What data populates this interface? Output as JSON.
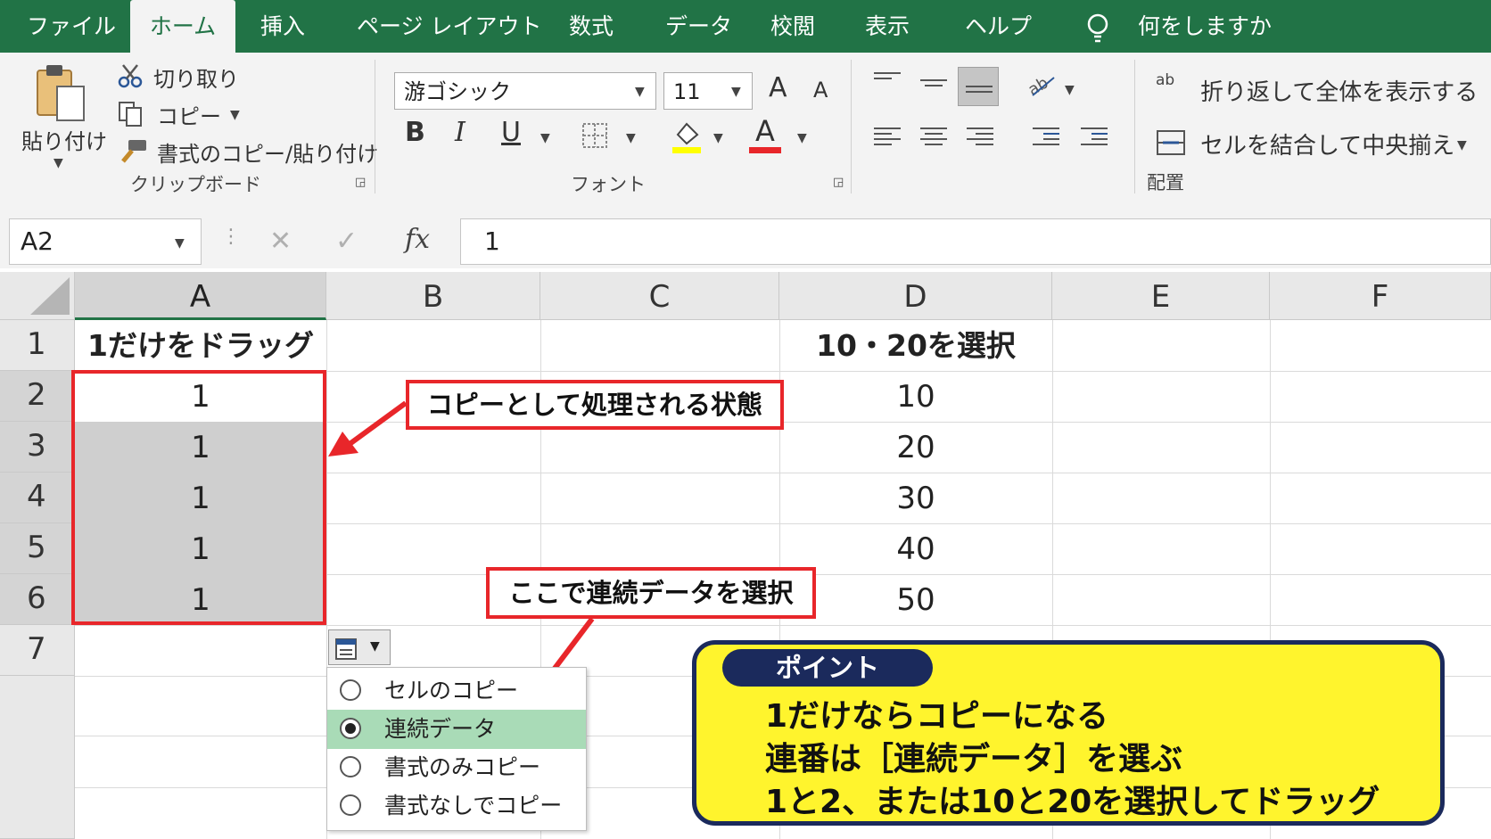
{
  "tabs": [
    "ファイル",
    "ホーム",
    "挿入",
    "ページ レイアウト",
    "数式",
    "データ",
    "校閲",
    "表示",
    "ヘルプ",
    "何をしますか"
  ],
  "active_tab": "ホーム",
  "clipboard": {
    "paste": "貼り付け",
    "cut": "切り取り",
    "copy": "コピー",
    "format_painter": "書式のコピー/貼り付け",
    "group": "クリップボード"
  },
  "font": {
    "name": "游ゴシック",
    "size": "11",
    "bold": "B",
    "italic": "I",
    "underline": "U",
    "font_color_letter": "A",
    "grow": "A",
    "shrink": "A",
    "group": "フォント"
  },
  "alignment": {
    "wrap": "折り返して全体を表示する",
    "merge": "セルを結合して中央揃え",
    "group": "配置",
    "wrap_icon_text": "ab"
  },
  "formula_bar": {
    "name_box": "A2",
    "fx": "fx",
    "value": "1"
  },
  "columns": [
    "A",
    "B",
    "C",
    "D",
    "E",
    "F"
  ],
  "rows": [
    "1",
    "2",
    "3",
    "4",
    "5",
    "6",
    "7"
  ],
  "cells": {
    "A1": "1だけをドラッグ",
    "A2": "1",
    "A3": "1",
    "A4": "1",
    "A5": "1",
    "A6": "1",
    "D1": "10・20を選択",
    "D2": "10",
    "D3": "20",
    "D4": "30",
    "D5": "40",
    "D6": "50"
  },
  "callouts": {
    "copy_state": "コピーとして処理される状態",
    "choose_series": "ここで連続データを選択"
  },
  "autofill_menu": {
    "items": [
      "セルのコピー",
      "連続データ",
      "書式のみコピー",
      "書式なしでコピー"
    ],
    "selected": "連続データ"
  },
  "point": {
    "title": "ポイント",
    "lines": [
      "1だけならコピーになる",
      "連番は［連続データ］を選ぶ",
      "1と2、または10と20を選択してドラッグ"
    ]
  },
  "colors": {
    "ribbon_green": "#217346",
    "highlight_red": "#e8262a",
    "point_yellow": "#fff42d",
    "point_navy": "#1b2a5c",
    "menu_selected": "#a9dbb7"
  }
}
